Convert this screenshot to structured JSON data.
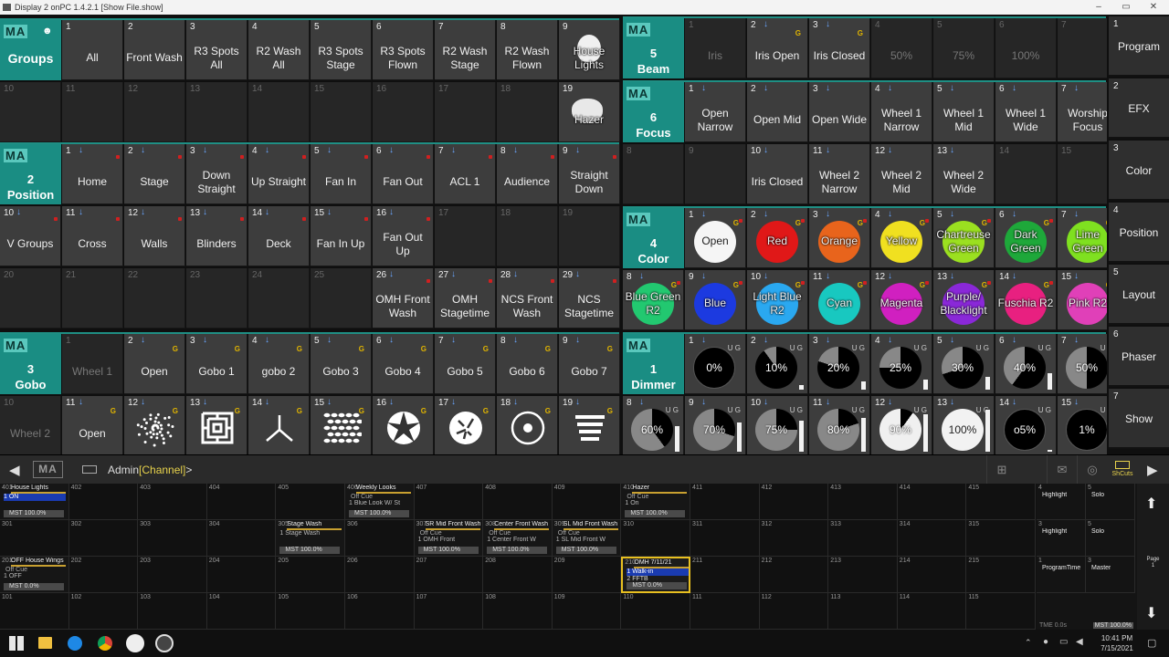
{
  "window": {
    "title": "Display 2 onPC 1.4.2.1 [Show File.show]"
  },
  "groups": {
    "ma": "MA",
    "name": "Groups",
    "row1": [
      {
        "n": "1",
        "l": "All"
      },
      {
        "n": "2",
        "l": "Front Wash"
      },
      {
        "n": "3",
        "l": "R3 Spots All"
      },
      {
        "n": "4",
        "l": "R2 Wash All"
      },
      {
        "n": "5",
        "l": "R3 Spots Stage"
      },
      {
        "n": "6",
        "l": "R3 Spots Flown"
      },
      {
        "n": "7",
        "l": "R2 Wash Stage"
      },
      {
        "n": "8",
        "l": "R2 Wash Flown"
      },
      {
        "n": "9",
        "l": "House Lights"
      }
    ],
    "row2": [
      "10",
      "11",
      "12",
      "13",
      "14",
      "15",
      "16",
      "17",
      "18"
    ],
    "hazer": {
      "n": "19",
      "l": "Hazer"
    }
  },
  "position": {
    "ma": "MA",
    "num": "2",
    "name": "Position",
    "row1": [
      {
        "n": "1",
        "l": "Home"
      },
      {
        "n": "2",
        "l": "Stage"
      },
      {
        "n": "3",
        "l": "Down Straight"
      },
      {
        "n": "4",
        "l": "Up Straight"
      },
      {
        "n": "5",
        "l": "Fan In"
      },
      {
        "n": "6",
        "l": "Fan Out"
      },
      {
        "n": "7",
        "l": "ACL 1"
      },
      {
        "n": "8",
        "l": "Audience"
      },
      {
        "n": "9",
        "l": "Straight Down"
      }
    ],
    "row2": [
      {
        "n": "10",
        "l": "V Groups"
      },
      {
        "n": "11",
        "l": "Cross"
      },
      {
        "n": "12",
        "l": "Walls"
      },
      {
        "n": "13",
        "l": "Blinders"
      },
      {
        "n": "14",
        "l": "Deck"
      },
      {
        "n": "15",
        "l": "Fan In Up"
      },
      {
        "n": "16",
        "l": "Fan Out Up"
      },
      {
        "n": "17",
        "l": ""
      },
      {
        "n": "18",
        "l": ""
      },
      {
        "n": "19",
        "l": ""
      }
    ],
    "row3": [
      {
        "n": "20",
        "l": ""
      },
      {
        "n": "21",
        "l": ""
      },
      {
        "n": "22",
        "l": ""
      },
      {
        "n": "23",
        "l": ""
      },
      {
        "n": "24",
        "l": ""
      },
      {
        "n": "25",
        "l": ""
      },
      {
        "n": "26",
        "l": "OMH Front Wash"
      },
      {
        "n": "27",
        "l": "OMH Stagetime"
      },
      {
        "n": "28",
        "l": "NCS Front Wash"
      },
      {
        "n": "29",
        "l": "NCS Stagetime"
      }
    ]
  },
  "gobo": {
    "ma": "MA",
    "num": "3",
    "name": "Gobo",
    "row1": [
      {
        "n": "1",
        "l": "Wheel 1"
      },
      {
        "n": "2",
        "l": "Open"
      },
      {
        "n": "3",
        "l": "Gobo 1"
      },
      {
        "n": "4",
        "l": "gobo 2"
      },
      {
        "n": "5",
        "l": "Gobo 3"
      },
      {
        "n": "6",
        "l": "Gobo 4"
      },
      {
        "n": "7",
        "l": "Gobo 5"
      },
      {
        "n": "8",
        "l": "Gobo 6"
      },
      {
        "n": "9",
        "l": "Gobo 7"
      }
    ],
    "row2": [
      {
        "n": "10",
        "l": "Wheel 2"
      },
      {
        "n": "11",
        "l": "Open"
      },
      {
        "n": "12",
        "icon": "dots-gobo-icon"
      },
      {
        "n": "13",
        "icon": "maze-gobo-icon"
      },
      {
        "n": "14",
        "icon": "tripod-gobo-icon"
      },
      {
        "n": "15",
        "icon": "grid-gobo-icon"
      },
      {
        "n": "16",
        "icon": "shatter-gobo-icon"
      },
      {
        "n": "17",
        "icon": "breakup-gobo-icon"
      },
      {
        "n": "18",
        "icon": "target-gobo-icon"
      },
      {
        "n": "19",
        "icon": "stripe-gobo-icon"
      }
    ]
  },
  "beam": {
    "ma": "MA",
    "num": "5",
    "name": "Beam",
    "cells": [
      {
        "n": "1",
        "l": "Iris",
        "dim": true
      },
      {
        "n": "2",
        "l": "Iris Open"
      },
      {
        "n": "3",
        "l": "Iris Closed"
      },
      {
        "n": "4",
        "l": "50%",
        "dim": true
      },
      {
        "n": "5",
        "l": "75%",
        "dim": true
      },
      {
        "n": "6",
        "l": "100%",
        "dim": true
      },
      {
        "n": "7",
        "l": "",
        "dim": true
      }
    ]
  },
  "focus": {
    "ma": "MA",
    "num": "6",
    "name": "Focus",
    "row1": [
      {
        "n": "1",
        "l": "Open Narrow"
      },
      {
        "n": "2",
        "l": "Open Mid"
      },
      {
        "n": "3",
        "l": "Open Wide"
      },
      {
        "n": "4",
        "l": "Wheel 1 Narrow"
      },
      {
        "n": "5",
        "l": "Wheel 1 Mid"
      },
      {
        "n": "6",
        "l": "Wheel 1 Wide"
      },
      {
        "n": "7",
        "l": "Worship Focus"
      }
    ],
    "row2": [
      {
        "n": "8",
        "l": ""
      },
      {
        "n": "9",
        "l": ""
      },
      {
        "n": "10",
        "l": "Iris Closed"
      },
      {
        "n": "11",
        "l": "Wheel 2 Narrow"
      },
      {
        "n": "12",
        "l": "Wheel 2 Mid"
      },
      {
        "n": "13",
        "l": "Wheel 2 Wide"
      },
      {
        "n": "14",
        "l": ""
      },
      {
        "n": "15",
        "l": ""
      }
    ]
  },
  "color": {
    "ma": "MA",
    "num": "4",
    "name": "Color",
    "row1": [
      {
        "n": "1",
        "l": "Open",
        "c": "#f5f5f5",
        "tc": "#222"
      },
      {
        "n": "2",
        "l": "Red",
        "c": "#e01818"
      },
      {
        "n": "3",
        "l": "Orange",
        "c": "#e8641c"
      },
      {
        "n": "4",
        "l": "Yellow",
        "c": "#f0e020"
      },
      {
        "n": "5",
        "l": "Chartreuse Green",
        "c": "#9be020"
      },
      {
        "n": "6",
        "l": "Dark Green",
        "c": "#1ea83a"
      },
      {
        "n": "7",
        "l": "Lime Green",
        "c": "#7fe020"
      }
    ],
    "row2": [
      {
        "n": "8",
        "l": "Blue Green R2",
        "c": "#22c870"
      },
      {
        "n": "9",
        "l": "Blue",
        "c": "#1c3ae0"
      },
      {
        "n": "10",
        "l": "Light Blue R2",
        "c": "#2aa8f0"
      },
      {
        "n": "11",
        "l": "Cyan",
        "c": "#18c8c0"
      },
      {
        "n": "12",
        "l": "Magenta",
        "c": "#d020c0"
      },
      {
        "n": "13",
        "l": "Purple/ Blacklight",
        "c": "#8a28d8"
      },
      {
        "n": "14",
        "l": "Fuschia R2",
        "c": "#e82080"
      },
      {
        "n": "15",
        "l": "Pink R2",
        "c": "#e040b8"
      }
    ]
  },
  "dimmer": {
    "ma": "MA",
    "num": "1",
    "name": "Dimmer",
    "row1": [
      {
        "n": "1",
        "l": "0%",
        "p": 0
      },
      {
        "n": "2",
        "l": "10%",
        "p": 10
      },
      {
        "n": "3",
        "l": "20%",
        "p": 20
      },
      {
        "n": "4",
        "l": "25%",
        "p": 25
      },
      {
        "n": "5",
        "l": "30%",
        "p": 30
      },
      {
        "n": "6",
        "l": "40%",
        "p": 40
      },
      {
        "n": "7",
        "l": "50%",
        "p": 50
      }
    ],
    "row2": [
      {
        "n": "8",
        "l": "60%",
        "p": 60
      },
      {
        "n": "9",
        "l": "70%",
        "p": 70
      },
      {
        "n": "10",
        "l": "75%",
        "p": 75
      },
      {
        "n": "11",
        "l": "80%",
        "p": 80
      },
      {
        "n": "12",
        "l": "90%",
        "p": 90
      },
      {
        "n": "13",
        "l": "100%",
        "p": 100
      },
      {
        "n": "14",
        "l": "o5%",
        "p": 5
      },
      {
        "n": "15",
        "l": "1%",
        "p": 1
      }
    ]
  },
  "sidebar": [
    {
      "n": "1",
      "l": "Program"
    },
    {
      "n": "2",
      "l": "EFX"
    },
    {
      "n": "3",
      "l": "Color"
    },
    {
      "n": "4",
      "l": "Position"
    },
    {
      "n": "5",
      "l": "Layout"
    },
    {
      "n": "6",
      "l": "Phaser"
    },
    {
      "n": "7",
      "l": "Show"
    }
  ],
  "cmdline": {
    "ma": "MA",
    "user": "Admin",
    "channel": "[Channel]",
    "suffix": ">",
    "shortcuts": "ShCuts"
  },
  "executors": {
    "row1": [
      {
        "n": "401",
        "t": "House Lights",
        "s": "1 ON",
        "m": "MST 100.0%",
        "w": 2
      },
      {
        "n": "402"
      },
      {
        "n": "403"
      },
      {
        "n": "404"
      },
      {
        "n": "405"
      },
      {
        "n": "406",
        "t": "Weekly Looks",
        "o": "Off Cue",
        "s": "1 Blue Look W/ St",
        "m": "MST 100.0%",
        "w": 2
      },
      {
        "n": "407"
      },
      {
        "n": "408"
      },
      {
        "n": "409"
      },
      {
        "n": "410",
        "t": "Hazer",
        "o": "Off Cue",
        "s": "1 On",
        "m": "MST 100.0%"
      },
      {
        "n": "411"
      },
      {
        "n": "412"
      },
      {
        "n": "413"
      },
      {
        "n": "414"
      },
      {
        "n": "415"
      }
    ],
    "row2": [
      {
        "n": "301"
      },
      {
        "n": "302"
      },
      {
        "n": "303"
      },
      {
        "n": "304"
      },
      {
        "n": "305",
        "t": "Stage Wash",
        "s": "1 Stage Wash",
        "m": "MST 100.0%",
        "w": 2
      },
      {
        "n": "306"
      },
      {
        "n": "307",
        "t": "SR Mid Front Wash",
        "o": "Off Cue",
        "s": "1 OMH Front",
        "m": "MST 100.0%"
      },
      {
        "n": "308",
        "t": "Center Front Wash",
        "o": "Off Cue",
        "s": "1 Center Front W",
        "m": "MST 100.0%"
      },
      {
        "n": "309",
        "t": "SL Mid Front Wash",
        "o": "Off Cue",
        "s": "1 SL Mid Front W",
        "m": "MST 100.0%"
      },
      {
        "n": "310"
      },
      {
        "n": "311"
      },
      {
        "n": "312"
      },
      {
        "n": "313"
      },
      {
        "n": "314"
      },
      {
        "n": "315"
      }
    ],
    "row3": [
      {
        "n": "201",
        "t": "OFF House Wings",
        "o": "Off Cue",
        "s": "1 OFF",
        "m": "MST 0.0%"
      },
      {
        "n": "202"
      },
      {
        "n": "203"
      },
      {
        "n": "204"
      },
      {
        "n": "205"
      },
      {
        "n": "206"
      },
      {
        "n": "207"
      },
      {
        "n": "208"
      },
      {
        "n": "209"
      },
      {
        "n": "210",
        "t": "OMH 7/11/21",
        "s": "1 Walk-in",
        "s2": "2 FFTB",
        "m": "MST 0.0%",
        "hl": true
      },
      {
        "n": "211"
      },
      {
        "n": "212"
      },
      {
        "n": "213"
      },
      {
        "n": "214"
      },
      {
        "n": "215"
      }
    ],
    "row4": [
      {
        "n": "101"
      },
      {
        "n": "102"
      },
      {
        "n": "103"
      },
      {
        "n": "104"
      },
      {
        "n": "105"
      },
      {
        "n": "106"
      },
      {
        "n": "107"
      },
      {
        "n": "108"
      },
      {
        "n": "109"
      },
      {
        "n": "110"
      },
      {
        "n": "111"
      },
      {
        "n": "112"
      },
      {
        "n": "113"
      },
      {
        "n": "114"
      },
      {
        "n": "115"
      }
    ]
  },
  "rightex": [
    {
      "n": "4",
      "t": "Highlight"
    },
    {
      "n": "5",
      "t": "Solo"
    },
    {
      "n": "3",
      "t": "Highlight"
    },
    {
      "n": "5",
      "t": "Solo"
    },
    {
      "n": "1",
      "t": "ProgramTime"
    },
    {
      "n": "3",
      "t": "Master"
    }
  ],
  "rightex_foot": {
    "time": "TME 0.0s",
    "mst": "MST 100.0%"
  },
  "rightnav": {
    "page_label": "Page",
    "page_num": "1"
  },
  "taskbar": {
    "time": "10:41 PM",
    "date": "7/15/2021"
  }
}
